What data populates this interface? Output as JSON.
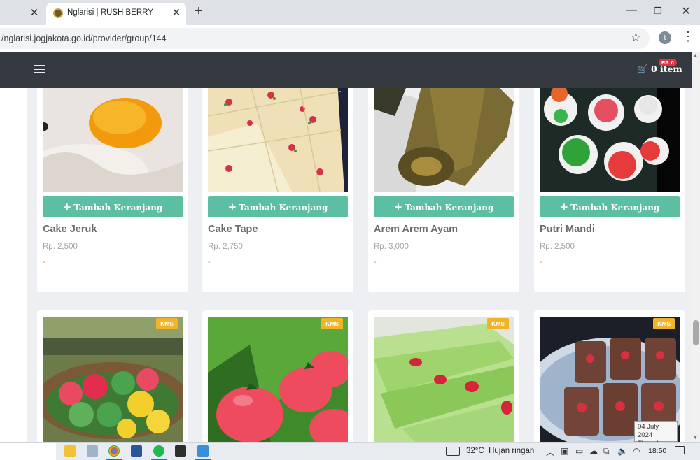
{
  "browser": {
    "active_tab_title": "Nglarisi | RUSH BERRY",
    "url": "/nglarisi.jogjakota.go.id/provider/group/144",
    "profile_initial": "t"
  },
  "navbar": {
    "cart_label": "0 item",
    "cart_badge": "RP. 0"
  },
  "products": [
    {
      "name": "Cake Jeruk",
      "price": "Rp. 2,500",
      "note": "-",
      "button": "Tambah Keranjang"
    },
    {
      "name": "Cake Tape",
      "price": "Rp. 2,750",
      "note": "-",
      "button": "Tambah Keranjang"
    },
    {
      "name": "Arem Arem Ayam",
      "price": "Rp. 3,000",
      "note": "-",
      "button": "Tambah Keranjang"
    },
    {
      "name": "Putri Mandi",
      "price": "Rp. 2,500",
      "note": "-",
      "button": "Tambah Keranjang"
    }
  ],
  "products_row2": [
    {
      "badge": "KMS"
    },
    {
      "badge": "KMS"
    },
    {
      "badge": "KMS"
    },
    {
      "badge": "KMS"
    }
  ],
  "taskbar": {
    "temperature": "32°C",
    "weather": "Hujan ringan",
    "time": "18:50"
  },
  "tooltip": {
    "date": "04 July 2024",
    "day": "Thursday"
  },
  "colors": {
    "navbar": "#343a40",
    "button": "#5cbfa3",
    "badge": "#f0b429",
    "cart_badge": "#dc3545"
  }
}
